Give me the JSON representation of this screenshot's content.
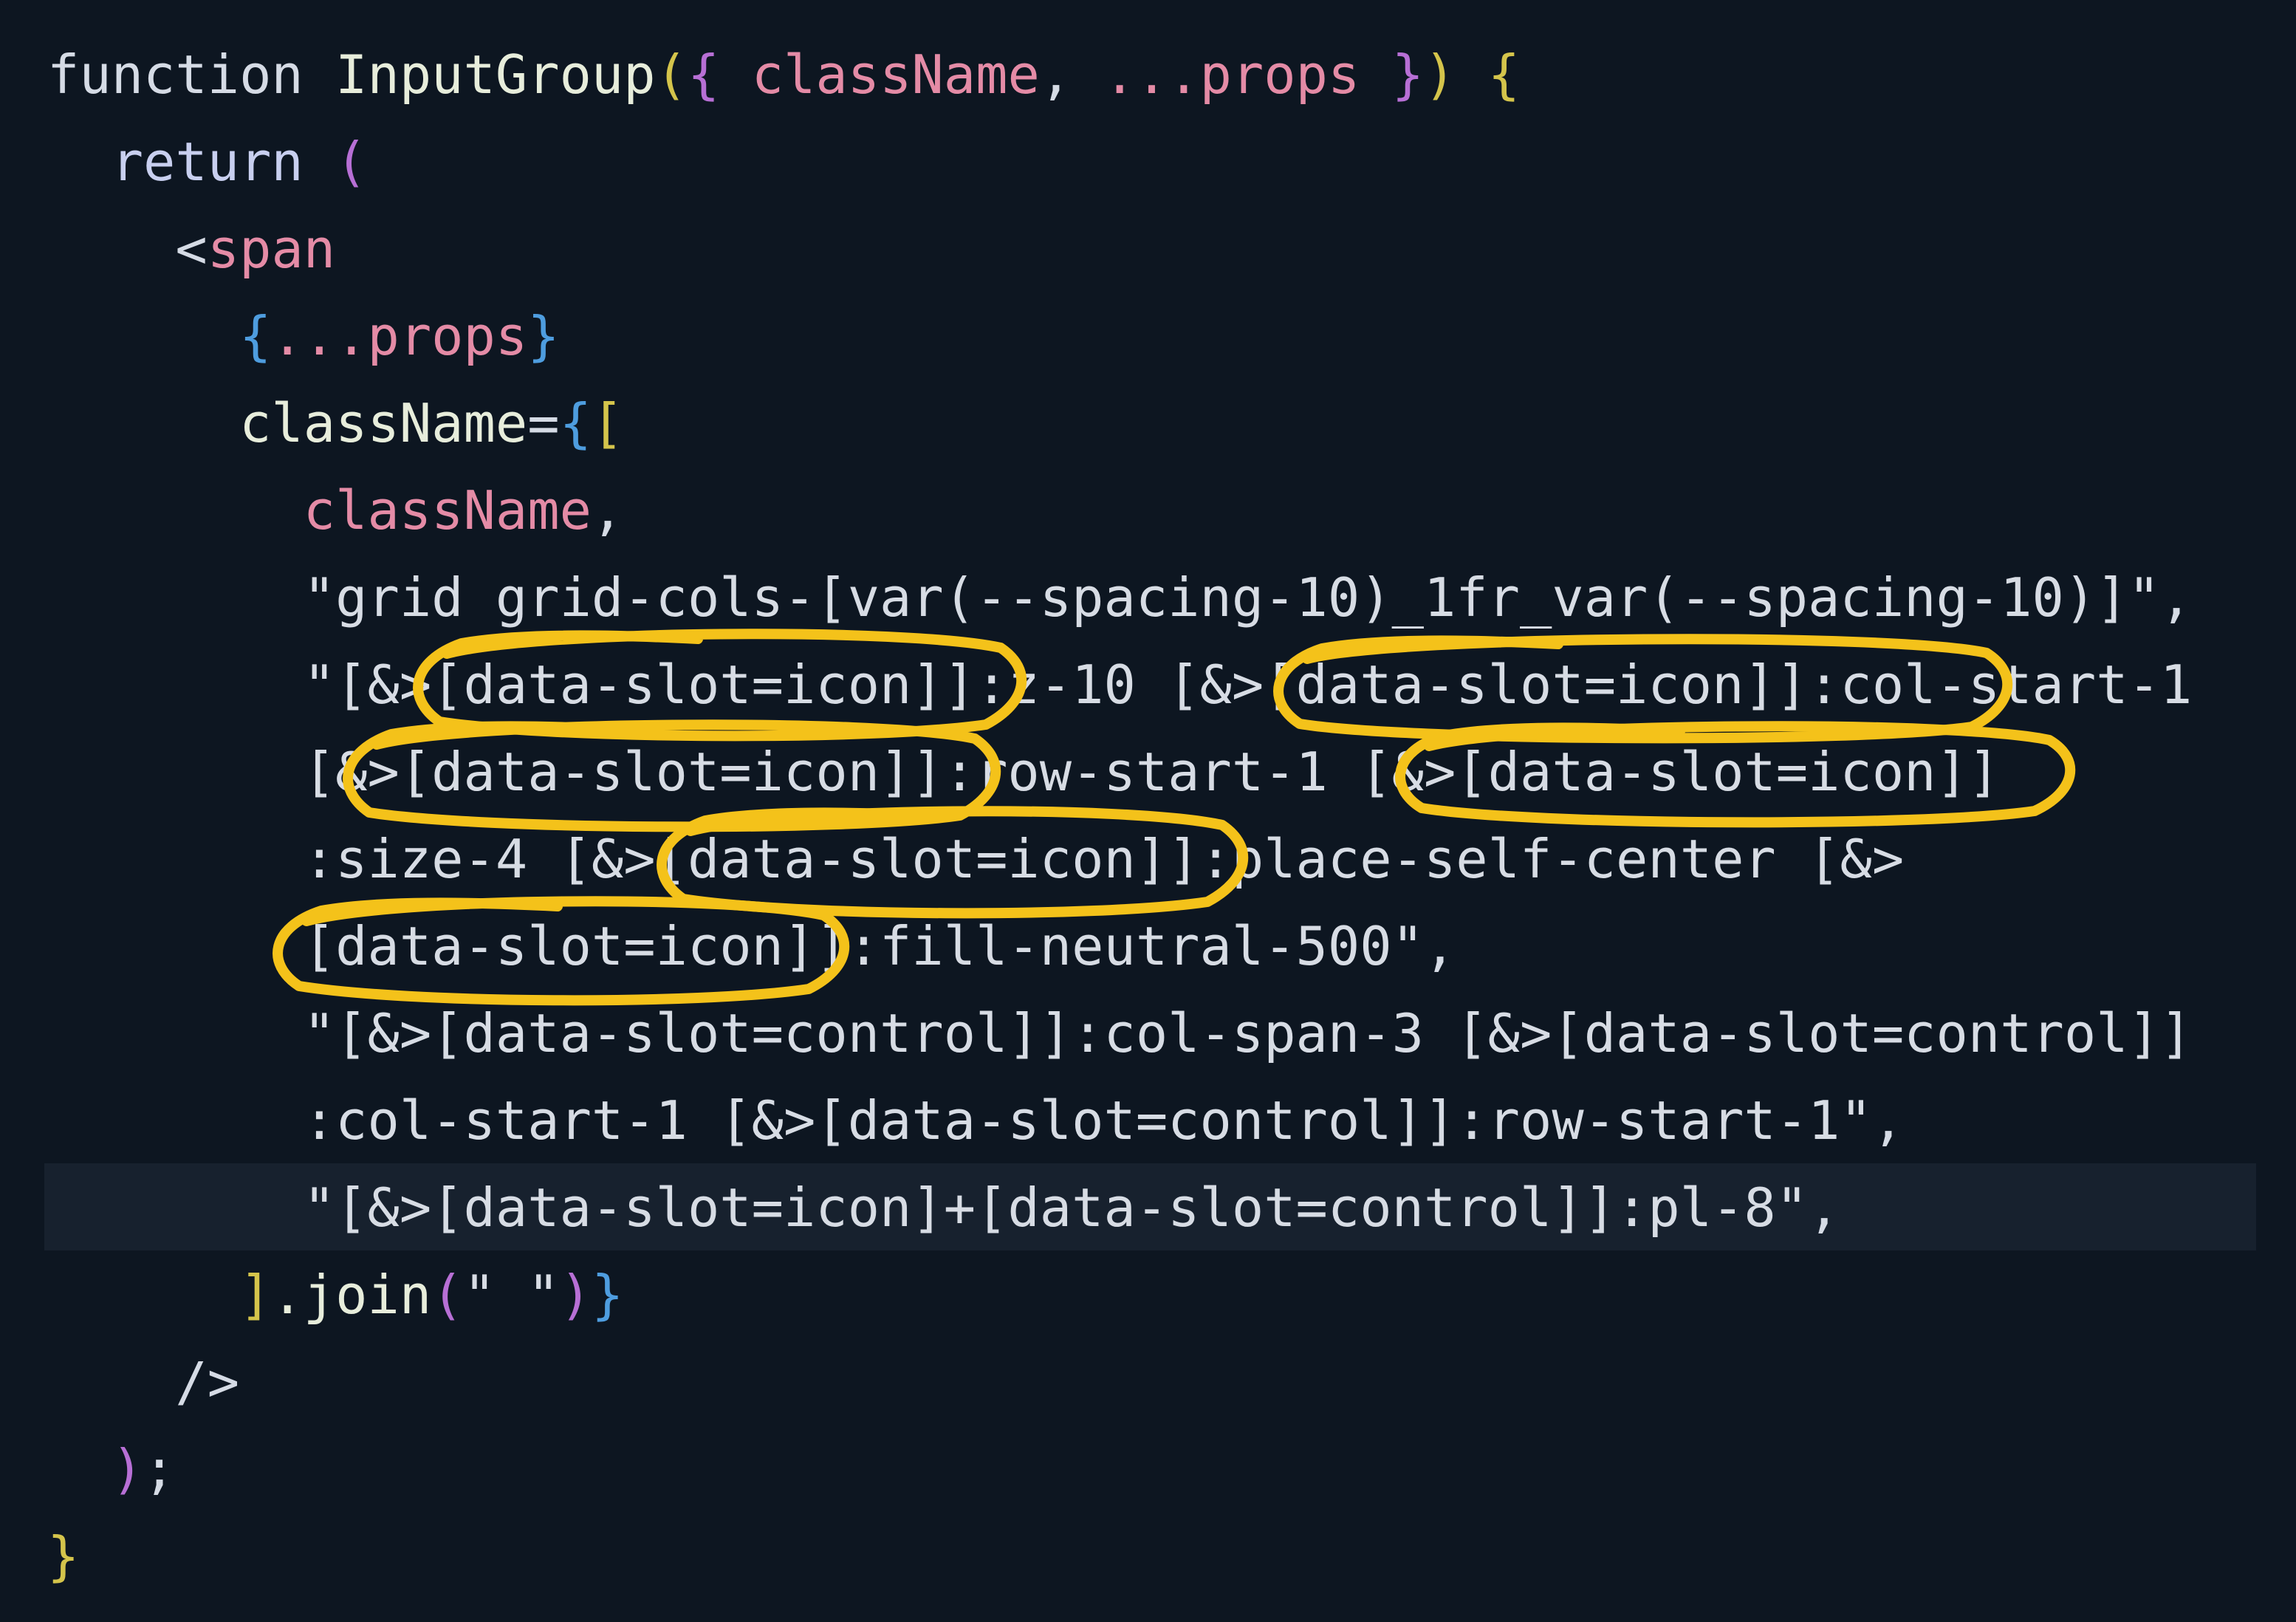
{
  "editor": {
    "lines": [
      [
        {
          "text": "function ",
          "cls": "t-kw"
        },
        {
          "text": "InputGroup",
          "cls": "t-fn"
        },
        {
          "text": "(",
          "cls": "t-br1"
        },
        {
          "text": "{ ",
          "cls": "t-br2"
        },
        {
          "text": "className",
          "cls": "t-var"
        },
        {
          "text": ", ",
          "cls": "t-pun"
        },
        {
          "text": "...props",
          "cls": "t-var"
        },
        {
          "text": " }",
          "cls": "t-br2"
        },
        {
          "text": ")",
          "cls": "t-br1"
        },
        {
          "text": " {",
          "cls": "t-br1"
        }
      ],
      [
        {
          "text": "  return ",
          "cls": "t-ret"
        },
        {
          "text": "(",
          "cls": "t-br2"
        }
      ],
      [
        {
          "text": "    <",
          "cls": "t-pun"
        },
        {
          "text": "span",
          "cls": "t-tag"
        }
      ],
      [
        {
          "text": "      {",
          "cls": "t-br3"
        },
        {
          "text": "...props",
          "cls": "t-var"
        },
        {
          "text": "}",
          "cls": "t-br3"
        }
      ],
      [
        {
          "text": "      className",
          "cls": "t-attr"
        },
        {
          "text": "=",
          "cls": "t-pun"
        },
        {
          "text": "{",
          "cls": "t-br3"
        },
        {
          "text": "[",
          "cls": "t-br1"
        }
      ],
      [
        {
          "text": "        className",
          "cls": "t-var"
        },
        {
          "text": ",",
          "cls": "t-pun"
        }
      ],
      [
        {
          "text": "        \"grid grid-cols-[var(--spacing-10)_1fr_var(--spacing-10)]\"",
          "cls": "t-str"
        },
        {
          "text": ",",
          "cls": "t-pun"
        }
      ],
      [
        {
          "text": "        \"[&>[data-slot=icon]]:z-10 [&>[data-slot=icon]]:col-start-1",
          "cls": "t-str"
        }
      ],
      [
        {
          "text": "        [&>[data-slot=icon]]:row-start-1 [&>[data-slot=icon]]",
          "cls": "t-str"
        }
      ],
      [
        {
          "text": "        :size-4 [&>[data-slot=icon]]:place-self-center [&>",
          "cls": "t-str"
        }
      ],
      [
        {
          "text": "        [data-slot=icon]]:fill-neutral-500\"",
          "cls": "t-str"
        },
        {
          "text": ",",
          "cls": "t-pun"
        }
      ],
      [
        {
          "text": "        \"[&>[data-slot=control]]:col-span-3 [&>[data-slot=control]]",
          "cls": "t-str"
        }
      ],
      [
        {
          "text": "        :col-start-1 [&>[data-slot=control]]:row-start-1\"",
          "cls": "t-str"
        },
        {
          "text": ",",
          "cls": "t-pun"
        }
      ],
      [
        {
          "text": "        \"[&>[data-slot=icon]+[data-slot=control]]:pl-8\"",
          "cls": "t-str"
        },
        {
          "text": ",",
          "cls": "t-pun"
        }
      ],
      [
        {
          "text": "      ",
          "cls": "t-pun"
        },
        {
          "text": "]",
          "cls": "t-br1"
        },
        {
          "text": ".join",
          "cls": "t-fn"
        },
        {
          "text": "(",
          "cls": "t-br2"
        },
        {
          "text": "\" \"",
          "cls": "t-str"
        },
        {
          "text": ")",
          "cls": "t-br2"
        },
        {
          "text": "}",
          "cls": "t-br3"
        }
      ],
      [
        {
          "text": "    />",
          "cls": "t-pun"
        }
      ],
      [
        {
          "text": "  )",
          "cls": "t-br2"
        },
        {
          "text": ";",
          "cls": "t-pun"
        }
      ],
      [
        {
          "text": "}",
          "cls": "t-br1"
        }
      ]
    ],
    "highlighted_line": 14
  },
  "annotations": {
    "color": "#f4c21a",
    "circled_text": "[data-slot=icon]",
    "count": 6
  }
}
